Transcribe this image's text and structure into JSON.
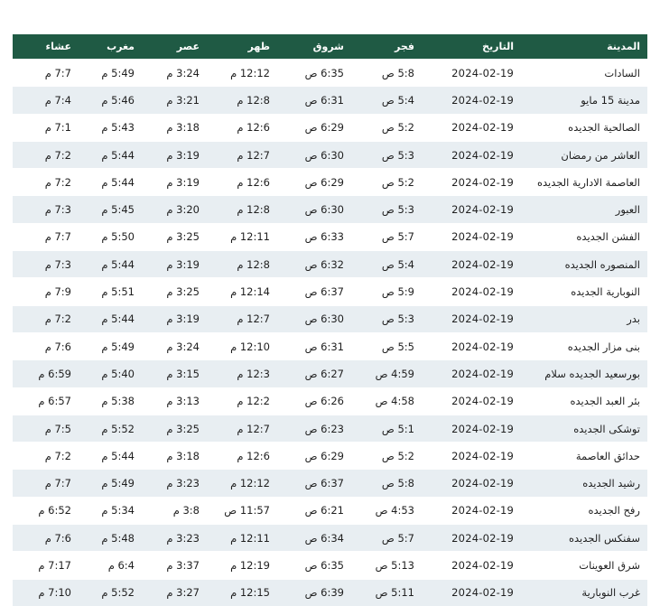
{
  "table": {
    "headers": {
      "city": "المدينة",
      "date": "التاريخ",
      "fajr": "فجر",
      "sunrise": "شروق",
      "dhuhr": "ظهر",
      "asr": "عصر",
      "maghrib": "مغرب",
      "isha": "عشاء"
    },
    "rows": [
      {
        "city": "السادات",
        "date": "2024-02-19",
        "fajr": "5:8 ص",
        "sunrise": "6:35 ص",
        "dhuhr": "12:12 م",
        "asr": "3:24 م",
        "maghrib": "5:49 م",
        "isha": "7:7 م"
      },
      {
        "city": "مدينة 15 مايو",
        "date": "2024-02-19",
        "fajr": "5:4 ص",
        "sunrise": "6:31 ص",
        "dhuhr": "12:8 م",
        "asr": "3:21 م",
        "maghrib": "5:46 م",
        "isha": "7:4 م"
      },
      {
        "city": "الصالحية الجديده",
        "date": "2024-02-19",
        "fajr": "5:2 ص",
        "sunrise": "6:29 ص",
        "dhuhr": "12:6 م",
        "asr": "3:18 م",
        "maghrib": "5:43 م",
        "isha": "7:1 م"
      },
      {
        "city": "العاشر من رمضان",
        "date": "2024-02-19",
        "fajr": "5:3 ص",
        "sunrise": "6:30 ص",
        "dhuhr": "12:7 م",
        "asr": "3:19 م",
        "maghrib": "5:44 م",
        "isha": "7:2 م"
      },
      {
        "city": "العاصمة الادارية الجديده",
        "date": "2024-02-19",
        "fajr": "5:2 ص",
        "sunrise": "6:29 ص",
        "dhuhr": "12:6 م",
        "asr": "3:19 م",
        "maghrib": "5:44 م",
        "isha": "7:2 م"
      },
      {
        "city": "العبور",
        "date": "2024-02-19",
        "fajr": "5:3 ص",
        "sunrise": "6:30 ص",
        "dhuhr": "12:8 م",
        "asr": "3:20 م",
        "maghrib": "5:45 م",
        "isha": "7:3 م"
      },
      {
        "city": "الفشن الجديده",
        "date": "2024-02-19",
        "fajr": "5:7 ص",
        "sunrise": "6:33 ص",
        "dhuhr": "12:11 م",
        "asr": "3:25 م",
        "maghrib": "5:50 م",
        "isha": "7:7 م"
      },
      {
        "city": "المنصوره الجديده",
        "date": "2024-02-19",
        "fajr": "5:4 ص",
        "sunrise": "6:32 ص",
        "dhuhr": "12:8 م",
        "asr": "3:19 م",
        "maghrib": "5:44 م",
        "isha": "7:3 م"
      },
      {
        "city": "النوبارية الجديده",
        "date": "2024-02-19",
        "fajr": "5:9 ص",
        "sunrise": "6:37 ص",
        "dhuhr": "12:14 م",
        "asr": "3:25 م",
        "maghrib": "5:51 م",
        "isha": "7:9 م"
      },
      {
        "city": "بدر",
        "date": "2024-02-19",
        "fajr": "5:3 ص",
        "sunrise": "6:30 ص",
        "dhuhr": "12:7 م",
        "asr": "3:19 م",
        "maghrib": "5:44 م",
        "isha": "7:2 م"
      },
      {
        "city": "بنى مزار الجديده",
        "date": "2024-02-19",
        "fajr": "5:5 ص",
        "sunrise": "6:31 ص",
        "dhuhr": "12:10 م",
        "asr": "3:24 م",
        "maghrib": "5:49 م",
        "isha": "7:6 م"
      },
      {
        "city": "بورسعيد الجديده سلام",
        "date": "2024-02-19",
        "fajr": "4:59 ص",
        "sunrise": "6:27 ص",
        "dhuhr": "12:3 م",
        "asr": "3:15 م",
        "maghrib": "5:40 م",
        "isha": "6:59 م"
      },
      {
        "city": "بئر العبد الجديده",
        "date": "2024-02-19",
        "fajr": "4:58 ص",
        "sunrise": "6:26 ص",
        "dhuhr": "12:2 م",
        "asr": "3:13 م",
        "maghrib": "5:38 م",
        "isha": "6:57 م"
      },
      {
        "city": "توشكى الجديده",
        "date": "2024-02-19",
        "fajr": "5:1 ص",
        "sunrise": "6:23 ص",
        "dhuhr": "12:7 م",
        "asr": "3:25 م",
        "maghrib": "5:52 م",
        "isha": "7:5 م"
      },
      {
        "city": "حدائق العاصمة",
        "date": "2024-02-19",
        "fajr": "5:2 ص",
        "sunrise": "6:29 ص",
        "dhuhr": "12:6 م",
        "asr": "3:18 م",
        "maghrib": "5:44 م",
        "isha": "7:2 م"
      },
      {
        "city": "رشيد الجديده",
        "date": "2024-02-19",
        "fajr": "5:8 ص",
        "sunrise": "6:37 ص",
        "dhuhr": "12:12 م",
        "asr": "3:23 م",
        "maghrib": "5:49 م",
        "isha": "7:7 م"
      },
      {
        "city": "رفح الجديده",
        "date": "2024-02-19",
        "fajr": "4:53 ص",
        "sunrise": "6:21 ص",
        "dhuhr": "11:57 ص",
        "asr": "3:8 م",
        "maghrib": "5:34 م",
        "isha": "6:52 م"
      },
      {
        "city": "سفنكس الجديده",
        "date": "2024-02-19",
        "fajr": "5:7 ص",
        "sunrise": "6:34 ص",
        "dhuhr": "12:11 م",
        "asr": "3:23 م",
        "maghrib": "5:48 م",
        "isha": "7:6 م"
      },
      {
        "city": "شرق العوينات",
        "date": "2024-02-19",
        "fajr": "5:13 ص",
        "sunrise": "6:35 ص",
        "dhuhr": "12:19 م",
        "asr": "3:37 م",
        "maghrib": "6:4 م",
        "isha": "7:17 م"
      },
      {
        "city": "غرب النوبارية",
        "date": "2024-02-19",
        "fajr": "5:11 ص",
        "sunrise": "6:39 ص",
        "dhuhr": "12:15 م",
        "asr": "3:27 م",
        "maghrib": "5:52 م",
        "isha": "7:10 م"
      }
    ]
  }
}
